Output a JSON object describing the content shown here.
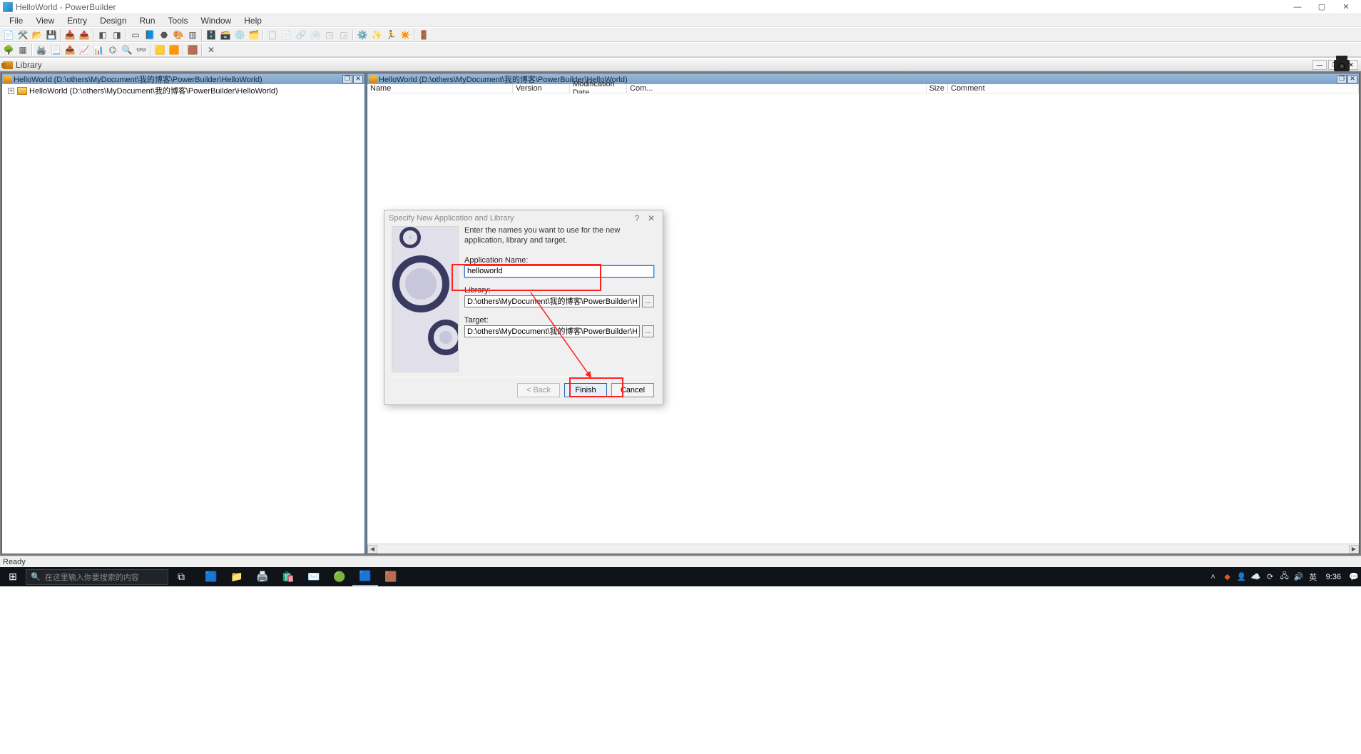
{
  "window": {
    "title": "HelloWorld - PowerBuilder"
  },
  "menus": [
    "File",
    "View",
    "Entry",
    "Design",
    "Run",
    "Tools",
    "Window",
    "Help"
  ],
  "toolwin": {
    "title": "Library"
  },
  "mdi": {
    "left": {
      "title": "HelloWorld (D:\\others\\MyDocument\\我的博客\\PowerBuilder\\HelloWorld)"
    },
    "right": {
      "title": "HelloWorld (D:\\others\\MyDocument\\我的博客\\PowerBuilder\\HelloWorld)"
    }
  },
  "tree": {
    "root": "HelloWorld (D:\\others\\MyDocument\\我的博客\\PowerBuilder\\HelloWorld)"
  },
  "columns": {
    "name": "Name",
    "version": "Version",
    "modification": "Modification Date",
    "com": "Com...",
    "size": "Size",
    "comment": "Comment"
  },
  "dialog": {
    "title": "Specify New Application and Library",
    "desc": "Enter the names you want to use for the new application, library and target.",
    "app_label": "Application Name:",
    "app_value": "helloworld",
    "lib_label": "Library:",
    "lib_value": "D:\\others\\MyDocument\\我的博客\\PowerBuilder\\HelloWorld\\hellov",
    "tgt_label": "Target:",
    "tgt_value": "D:\\others\\MyDocument\\我的博客\\PowerBuilder\\HelloWorld\\hellov",
    "back": "< Back",
    "finish": "Finish",
    "cancel": "Cancel",
    "help": "?",
    "close": "✕",
    "browse": "..."
  },
  "status": {
    "ready": "Ready"
  },
  "taskbar": {
    "search_placeholder": "在这里输入你要搜索的内容",
    "clock": "9:36"
  }
}
